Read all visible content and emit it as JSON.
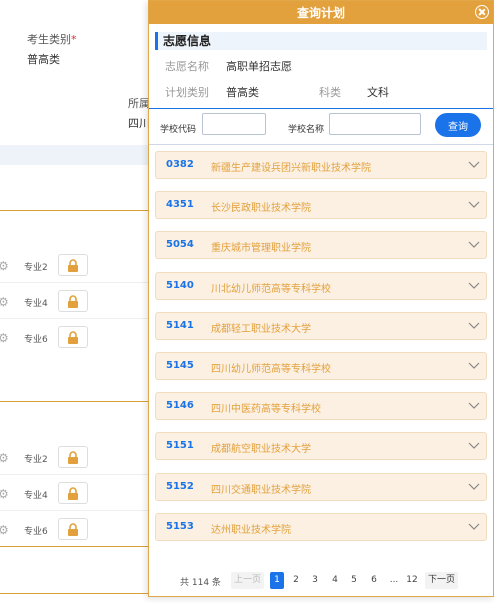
{
  "background": {
    "field_label": "考生类别",
    "required_mark": "*",
    "field_value": "普高类",
    "partial_label": "所属",
    "partial_value": "四川",
    "section_a_slots": [
      "专业2",
      "专业4",
      "专业6"
    ],
    "section_b_slots": [
      "专业2",
      "专业4",
      "专业6"
    ]
  },
  "dialog": {
    "title": "查询计划",
    "section_title": "志愿信息",
    "info": {
      "wish_name_label": "志愿名称",
      "wish_name_value": "高职单招志愿",
      "plan_type_label": "计划类别",
      "plan_type_value": "普高类",
      "subject_label": "科类",
      "subject_value": "文科"
    },
    "search": {
      "code_label": "学校代码",
      "code_value": "",
      "name_label": "学校名称",
      "name_value": "",
      "query_label": "查询"
    },
    "schools": [
      {
        "code": "0382",
        "name": "新疆生产建设兵团兴新职业技术学院"
      },
      {
        "code": "4351",
        "name": "长沙民政职业技术学院"
      },
      {
        "code": "5054",
        "name": "重庆城市管理职业学院"
      },
      {
        "code": "5140",
        "name": "川北幼儿师范高等专科学校"
      },
      {
        "code": "5141",
        "name": "成都轻工职业技术大学"
      },
      {
        "code": "5145",
        "name": "四川幼儿师范高等专科学校"
      },
      {
        "code": "5146",
        "name": "四川中医药高等专科学校"
      },
      {
        "code": "5151",
        "name": "成都航空职业技术大学"
      },
      {
        "code": "5152",
        "name": "四川交通职业技术学院"
      },
      {
        "code": "5153",
        "name": "达州职业技术学院"
      }
    ],
    "pagination": {
      "total_text": "共 114 条",
      "prev_label": "上一页",
      "pages": [
        "1",
        "2",
        "3",
        "4",
        "5",
        "6",
        "...",
        "12"
      ],
      "current_page": "1",
      "next_label": "下一页"
    }
  },
  "colors": {
    "accent_orange": "#e3a13d",
    "accent_blue": "#1a73e8",
    "item_bg": "#fbf0e2"
  }
}
